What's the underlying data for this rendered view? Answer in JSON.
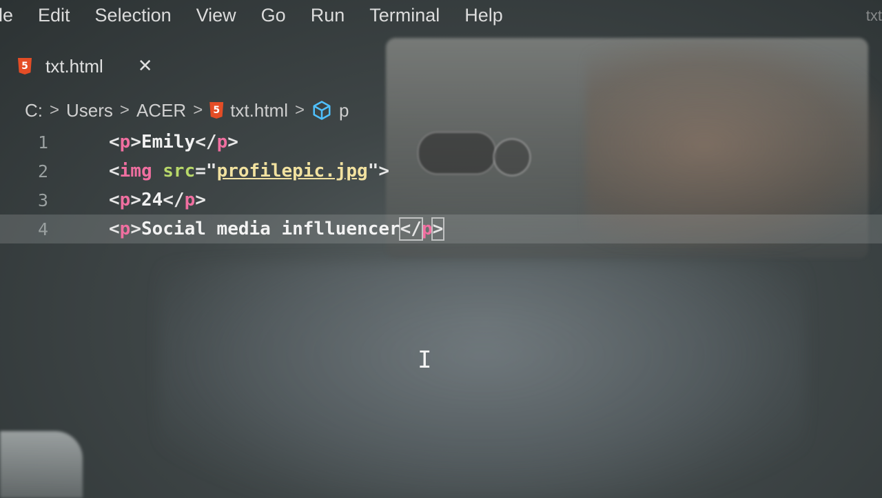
{
  "menu": [
    "le",
    "Edit",
    "Selection",
    "View",
    "Go",
    "Run",
    "Terminal",
    "Help"
  ],
  "menu_right": "txt",
  "tab": {
    "icon": "html5-icon",
    "title": "txt.html",
    "close": "✕"
  },
  "breadcrumb": {
    "items": [
      "C:",
      "Users",
      "ACER"
    ],
    "file": "txt.html",
    "symbol": "p",
    "sep": ">"
  },
  "editor": {
    "lines": [
      {
        "num": "1"
      },
      {
        "num": "2"
      },
      {
        "num": "3"
      },
      {
        "num": "4"
      }
    ],
    "l1": {
      "open": "<",
      "t1": "p",
      "c1": ">",
      "text": "Emily",
      "open2": "</",
      "t2": "p",
      "c2": ">"
    },
    "l2": {
      "open": "<",
      "t1": "img",
      "attr": "src",
      "eq": "=\"",
      "val": "profilepic.jpg",
      "close": "\">"
    },
    "l3": {
      "open": "<",
      "t1": "p",
      "c1": ">",
      "text": "24",
      "open2": "</",
      "t2": "p",
      "c2": ">"
    },
    "l4": {
      "open": "<",
      "t1": "p",
      "c1": ">",
      "text": "Social media inflluencer",
      "open2": "</",
      "t2": "p",
      "c2": ">"
    }
  },
  "cursor": "I"
}
